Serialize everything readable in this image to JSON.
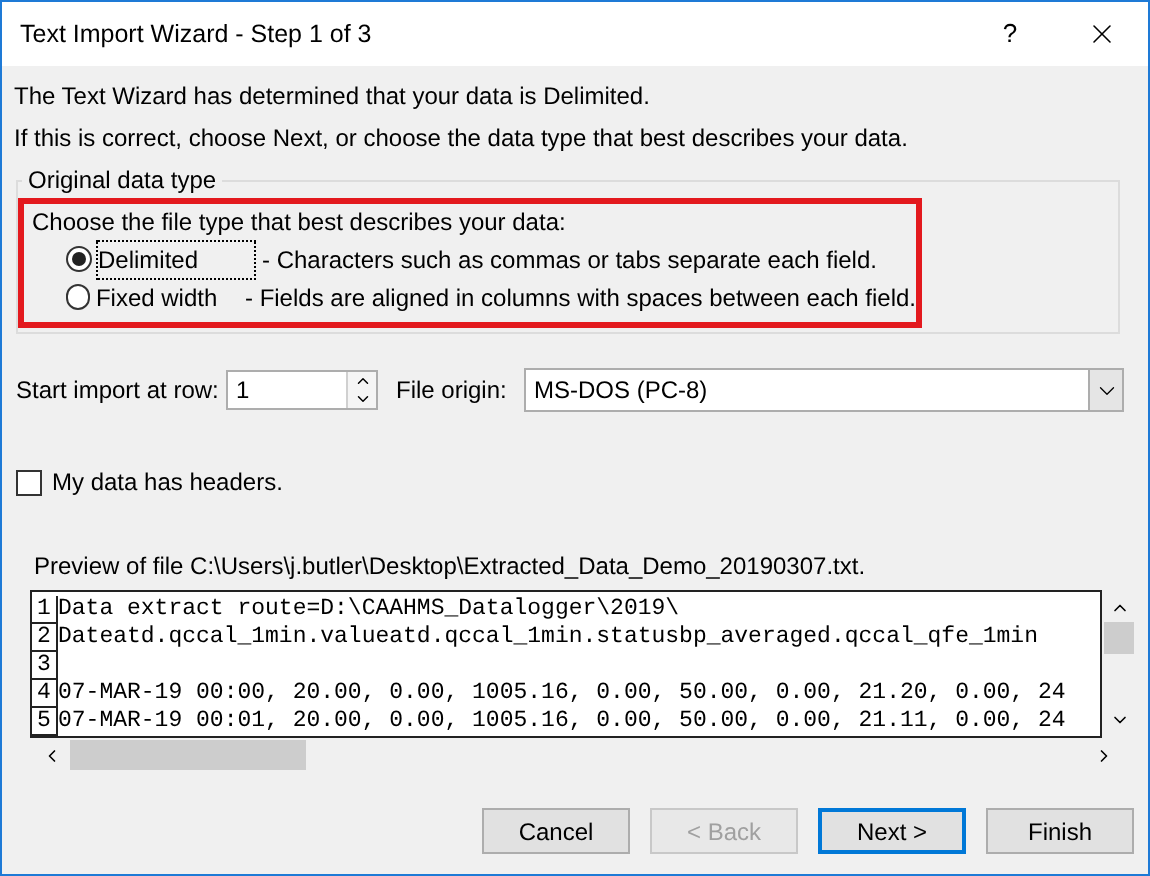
{
  "window": {
    "title": "Text Import Wizard - Step 1 of 3",
    "help": "?"
  },
  "intro": [
    "The Text Wizard has determined that your data is Delimited.",
    "If this is correct, choose Next, or choose the data type that best describes your data."
  ],
  "data_type": {
    "legend": "Original data type",
    "prompt": "Choose the file type that best describes your data:",
    "options": [
      {
        "label": "Delimited",
        "description": "- Characters such as commas or tabs separate each field.",
        "selected": true
      },
      {
        "label": "Fixed width",
        "description": "- Fields are aligned in columns with spaces between each field.",
        "selected": false
      }
    ]
  },
  "start_row": {
    "label": "Start import at row:",
    "value": "1"
  },
  "file_origin": {
    "label": "File origin:",
    "value": "MS-DOS (PC-8)"
  },
  "headers": {
    "label": "My data has headers.",
    "checked": false
  },
  "preview": {
    "label": "Preview of file C:\\Users\\j.butler\\Desktop\\Extracted_Data_Demo_20190307.txt.",
    "lines": [
      {
        "number": "1",
        "text": "Data extract route=D:\\CAAHMS_Datalogger\\2019\\"
      },
      {
        "number": "2",
        "text": "Dateatd.qccal_1min.valueatd.qccal_1min.statusbp_averaged.qccal_qfe_1min"
      },
      {
        "number": "3"
      },
      {
        "number": "4",
        "text": "07-MAR-19 00:00, 20.00, 0.00, 1005.16, 0.00, 50.00, 0.00, 21.20, 0.00, 24"
      },
      {
        "number": "5",
        "text": "07-MAR-19 00:01, 20.00, 0.00, 1005.16, 0.00, 50.00, 0.00, 21.11, 0.00, 24"
      }
    ]
  },
  "buttons": [
    {
      "label": "Cancel",
      "disabled": false,
      "default": false
    },
    {
      "label": "< Back",
      "disabled": true,
      "default": false
    },
    {
      "label": "Next >",
      "disabled": false,
      "default": true
    },
    {
      "label": "Finish",
      "disabled": false,
      "default": false
    }
  ]
}
